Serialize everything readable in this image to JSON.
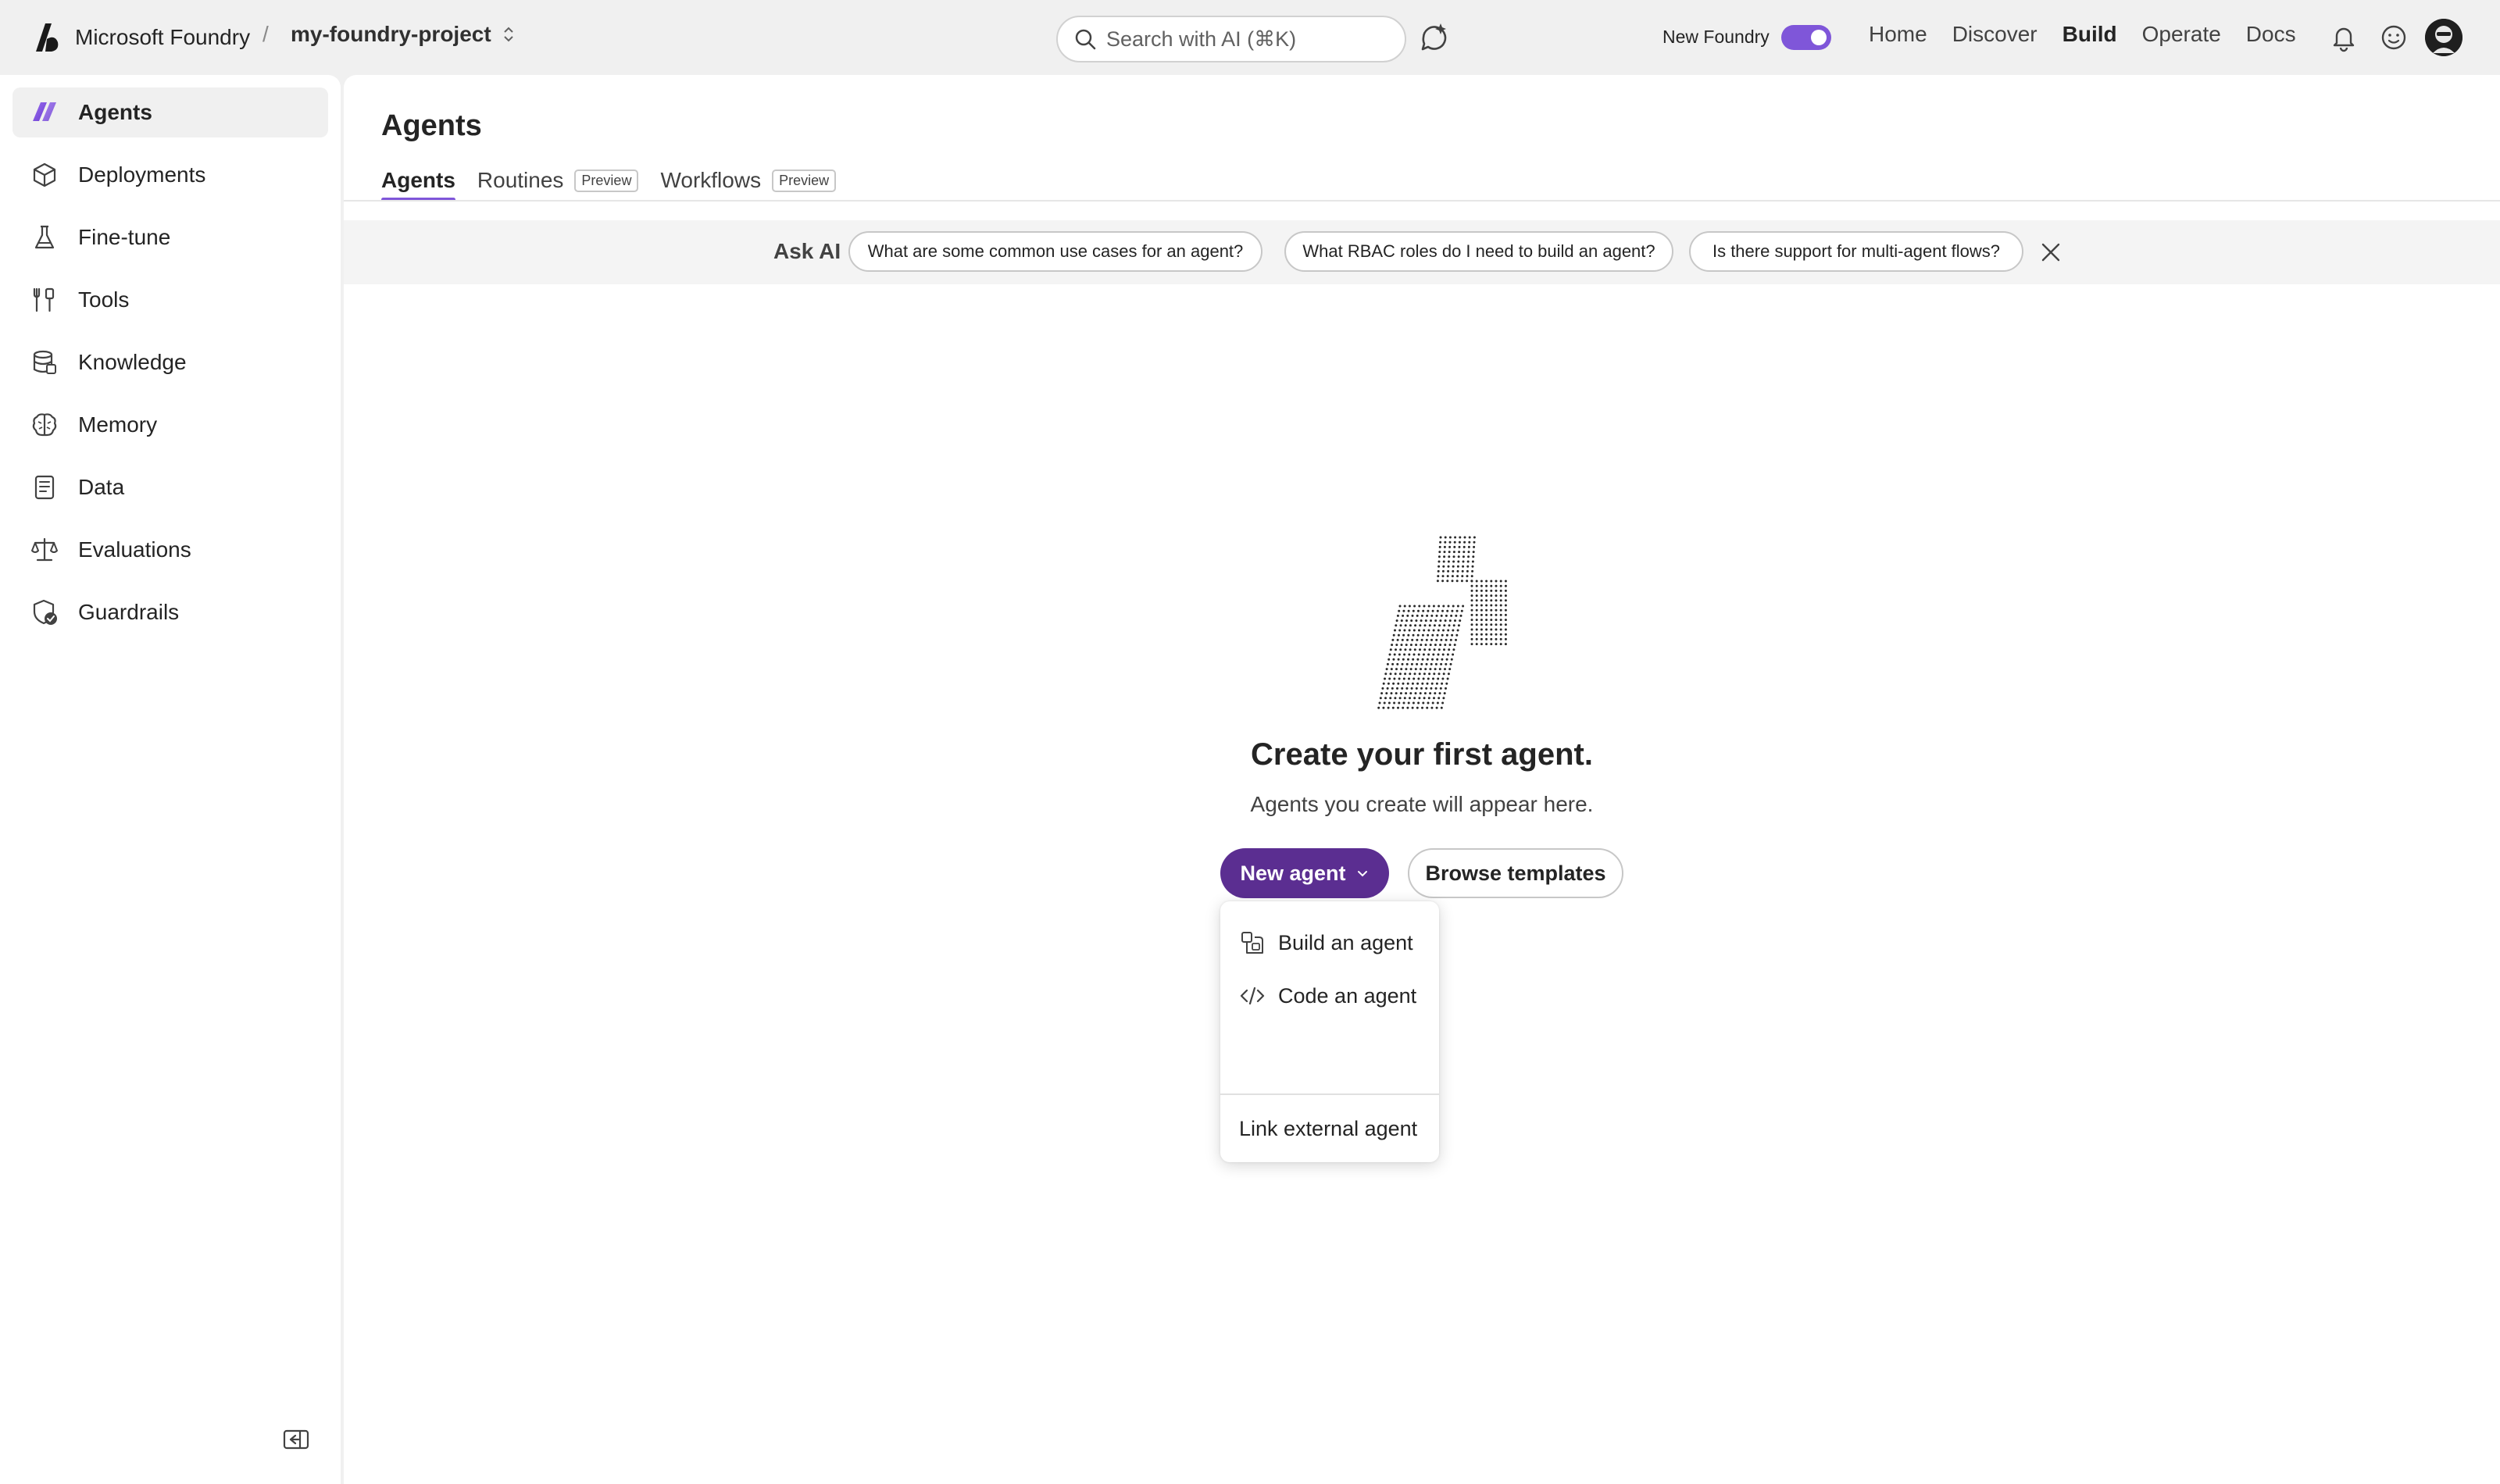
{
  "app": {
    "brand": "Microsoft Foundry",
    "breadcrumb_separator": "/",
    "project": "my-foundry-project"
  },
  "search": {
    "placeholder": "Search with AI (⌘K)"
  },
  "toggle": {
    "label": "New Foundry",
    "on": true
  },
  "topnav": {
    "items": [
      {
        "label": "Home",
        "active": false
      },
      {
        "label": "Discover",
        "active": false
      },
      {
        "label": "Build",
        "active": true
      },
      {
        "label": "Operate",
        "active": false
      },
      {
        "label": "Docs",
        "active": false
      }
    ]
  },
  "sidebar": {
    "items": [
      {
        "label": "Agents",
        "icon": "agents-icon",
        "active": true
      },
      {
        "label": "Deployments",
        "icon": "cube-icon"
      },
      {
        "label": "Fine-tune",
        "icon": "flask-icon"
      },
      {
        "label": "Tools",
        "icon": "wrench-icon"
      },
      {
        "label": "Knowledge",
        "icon": "database-icon"
      },
      {
        "label": "Memory",
        "icon": "brain-icon"
      },
      {
        "label": "Data",
        "icon": "document-icon"
      },
      {
        "label": "Evaluations",
        "icon": "scale-icon"
      },
      {
        "label": "Guardrails",
        "icon": "shield-check-icon"
      }
    ]
  },
  "page": {
    "title": "Agents",
    "tabs": [
      {
        "label": "Agents",
        "active": true,
        "badge": ""
      },
      {
        "label": "Routines",
        "badge": "Preview"
      },
      {
        "label": "Workflows",
        "badge": "Preview"
      }
    ]
  },
  "askai": {
    "label": "Ask AI",
    "chips": [
      "What are some common use cases for an agent?",
      "What RBAC roles do I need to build an agent?",
      "Is there support for multi-agent flows?"
    ]
  },
  "empty_state": {
    "title": "Create your first agent.",
    "subtitle": "Agents you create will appear here.",
    "primary_button": "New agent",
    "secondary_button": "Browse templates"
  },
  "new_agent_menu": {
    "items": [
      {
        "label": "Build an agent",
        "icon": "build-agent-icon"
      },
      {
        "label": "Code an agent",
        "icon": "code-icon"
      },
      {
        "label": "Link external agent",
        "icon": ""
      }
    ]
  },
  "colors": {
    "accent": "#7f56d9",
    "primary_button": "#5b2e91",
    "shell_background": "#f0f0f0"
  }
}
